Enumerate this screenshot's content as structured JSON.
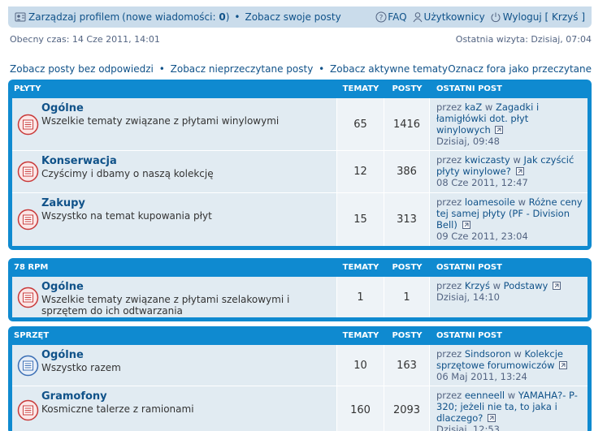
{
  "nav": {
    "profile_link": "Zarządzaj profilem",
    "new_messages_prefix": "(nowe wiadomości: ",
    "new_messages_count": "0",
    "new_messages_suffix": ")",
    "own_posts_link": "Zobacz swoje posty",
    "faq": "FAQ",
    "users": "Użytkownicy",
    "logout": "Wyloguj [ Krzyś ]"
  },
  "time": {
    "current": "Obecny czas: 14 Cze 2011, 14:01",
    "last_visit": "Ostatnia wizyta: Dzisiaj, 07:04"
  },
  "quicklinks": {
    "unanswered": "Zobacz posty bez odpowiedzi",
    "unread": "Zobacz nieprzeczytane posty",
    "active": "Zobacz aktywne tematy",
    "mark_read": "Oznacz fora jako przeczytane"
  },
  "columns": {
    "topics": "TEMATY",
    "posts": "POSTY",
    "last_post": "OSTATNI POST"
  },
  "categories": [
    {
      "name": "PŁYTY",
      "forums": [
        {
          "title": "Ogólne",
          "desc": "Wszelkie tematy związane z płytami winylowymi",
          "topics": "65",
          "posts": "1416",
          "by": "przez",
          "author": "kaZ",
          "in": "w",
          "topic": "Zagadki i łamigłówki dot. płyt winylowych",
          "date": "Dzisiaj, 09:48"
        },
        {
          "title": "Konserwacja",
          "desc": "Czyścimy i dbamy o naszą kolekcję",
          "topics": "12",
          "posts": "386",
          "by": "przez",
          "author": "kwiczasty",
          "in": "w",
          "topic": "Jak czyścić płyty winylowe?",
          "date": "08 Cze 2011, 12:47"
        },
        {
          "title": "Zakupy",
          "desc": "Wszystko na temat kupowania płyt",
          "topics": "15",
          "posts": "313",
          "by": "przez",
          "author": "loamesoile",
          "in": "w",
          "topic": "Różne ceny tej samej płyty (PF - Division Bell)",
          "date": "09 Cze 2011, 23:04"
        }
      ]
    },
    {
      "name": "78 RPM",
      "forums": [
        {
          "title": "Ogólne",
          "desc": "Wszelkie tematy związane z płytami szelakowymi i sprzętem do ich odtwarzania",
          "topics": "1",
          "posts": "1",
          "by": "przez",
          "author": "Krzyś",
          "in": "w",
          "topic": "Podstawy",
          "date": "Dzisiaj, 14:10"
        }
      ]
    },
    {
      "name": "SPRZĘT",
      "forums": [
        {
          "title": "Ogólne",
          "desc": "Wszystko razem",
          "topics": "10",
          "posts": "163",
          "by": "przez",
          "author": "Sindsoron",
          "in": "w",
          "topic": "Kolekcje sprzętowe forumowiczów",
          "date": "06 Maj 2011, 13:24"
        },
        {
          "title": "Gramofony",
          "desc": "Kosmiczne talerze z ramionami",
          "topics": "160",
          "posts": "2093",
          "by": "przez",
          "author": "eenneell",
          "in": "w",
          "topic": "YAMAHA?- P-320; jeżeli nie ta, to jaka i dlaczego?",
          "date": "Dzisiaj, 12:53"
        }
      ]
    }
  ],
  "colors": {
    "accent": "#0f8ad0",
    "link": "#105289",
    "row_bg": "#e1ebf2",
    "topbar_bg": "#cadceb",
    "unread_icon": "#c93a3a",
    "read_icon": "#3b6fb5"
  }
}
